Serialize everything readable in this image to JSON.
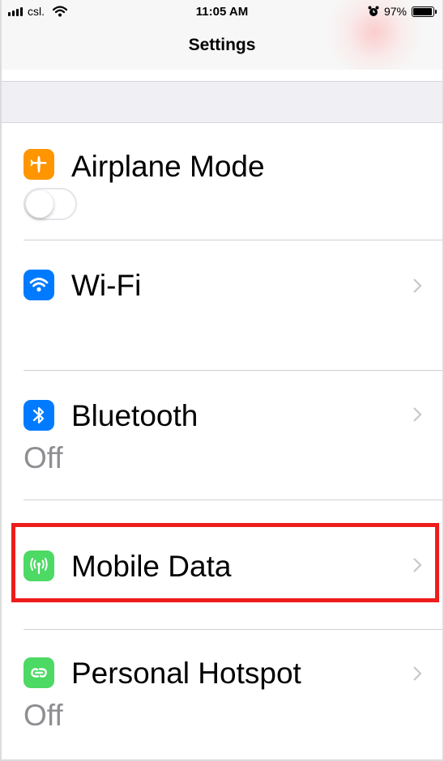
{
  "status_bar": {
    "carrier": "csl.",
    "time": "11:05 AM",
    "battery_percent": "97%",
    "battery_level": 0.97,
    "icons": [
      "signal-icon",
      "wifi-icon",
      "alarm-icon",
      "battery-icon"
    ]
  },
  "nav": {
    "title": "Settings"
  },
  "settings": {
    "airplane": {
      "label": "Airplane Mode",
      "icon": "airplane-icon",
      "icon_color": "#ff9500",
      "toggle_on": false
    },
    "wifi": {
      "label": "Wi-Fi",
      "icon": "wifi-icon",
      "icon_color": "#007aff",
      "value": ""
    },
    "bluetooth": {
      "label": "Bluetooth",
      "icon": "bluetooth-icon",
      "icon_color": "#007aff",
      "value": "Off"
    },
    "mobile_data": {
      "label": "Mobile Data",
      "icon": "antenna-icon",
      "icon_color": "#4cd964",
      "highlighted": true
    },
    "hotspot": {
      "label": "Personal Hotspot",
      "icon": "hotspot-icon",
      "icon_color": "#4cd964",
      "value": "Off"
    }
  },
  "colors": {
    "highlight_border": "#ee1c1c",
    "secondary_text": "#8e8e93",
    "group_background": "#efeff4"
  }
}
